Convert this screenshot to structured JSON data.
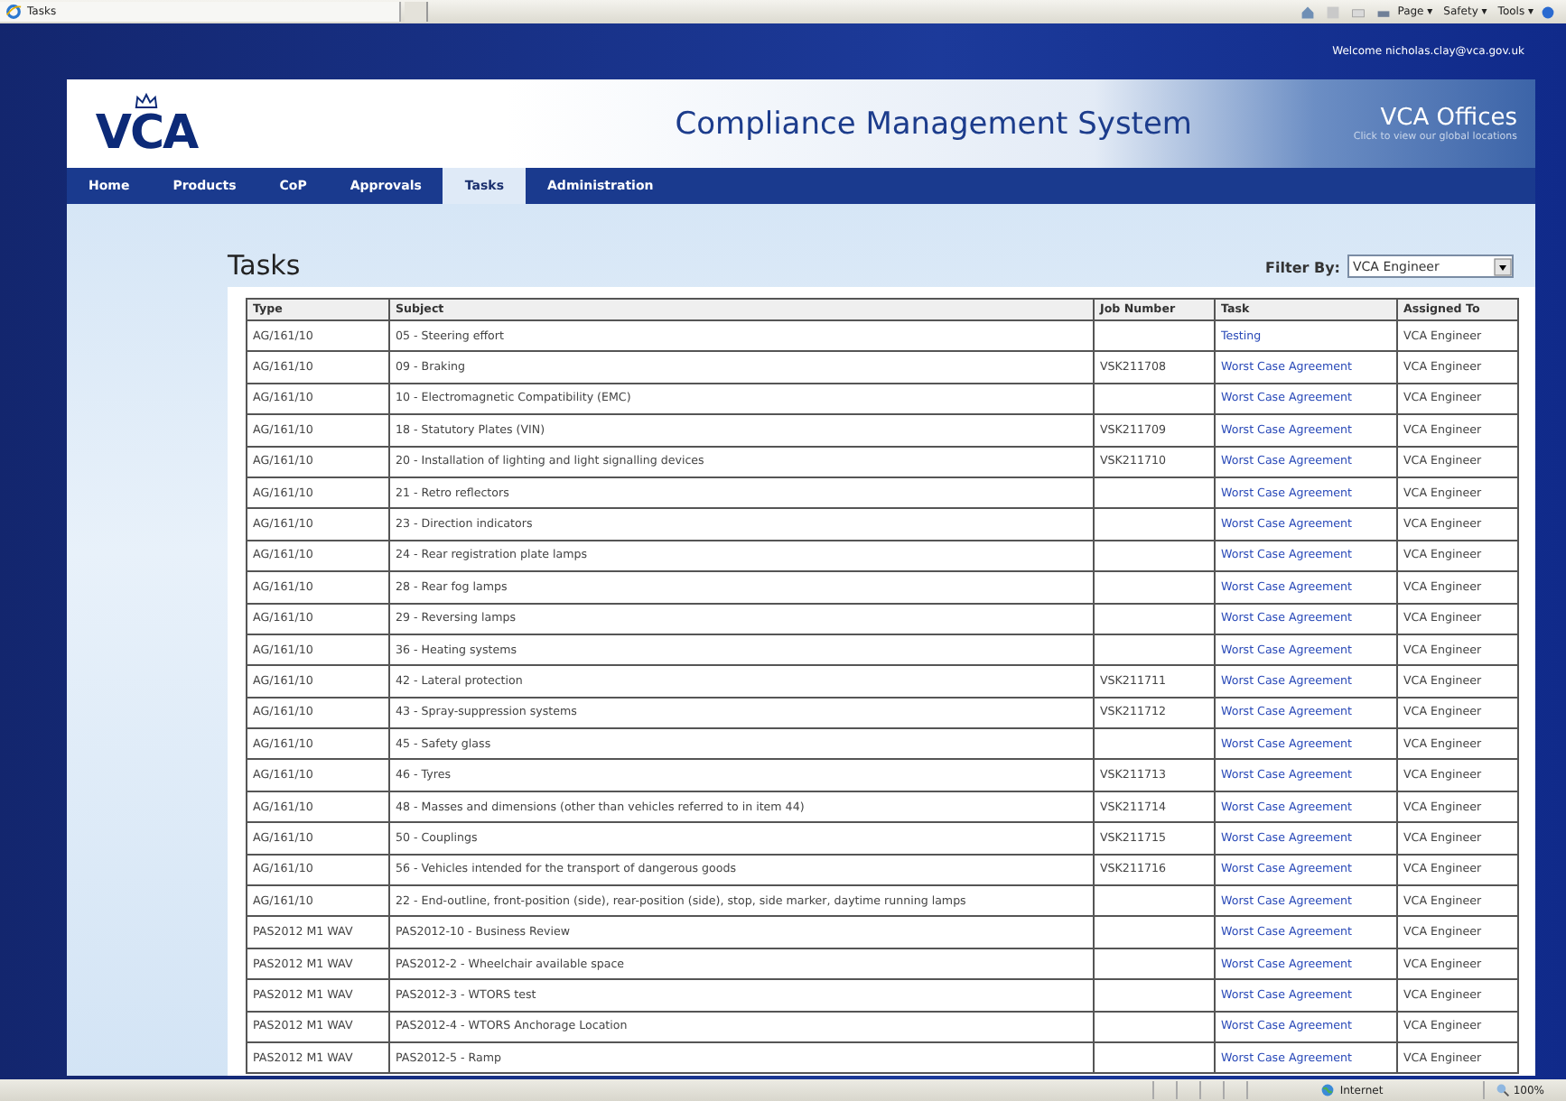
{
  "browser": {
    "tab_title": "Tasks",
    "commands": [
      "Page ▾",
      "Safety ▾",
      "Tools ▾"
    ],
    "status_zone": "Internet",
    "zoom": "100%"
  },
  "header": {
    "welcome": "Welcome nicholas.clay@vca.gov.uk",
    "logo_text": "VCA",
    "title": "Compliance Management System",
    "offices_title": "VCA Offices",
    "offices_subtitle": "Click to view our global locations"
  },
  "nav": [
    {
      "label": "Home",
      "selected": false
    },
    {
      "label": "Products",
      "selected": false
    },
    {
      "label": "CoP",
      "selected": false
    },
    {
      "label": "Approvals",
      "selected": false
    },
    {
      "label": "Tasks",
      "selected": true
    },
    {
      "label": "Administration",
      "selected": false
    }
  ],
  "page": {
    "heading": "Tasks",
    "filter_label": "Filter By:",
    "filter_value": "VCA Engineer"
  },
  "table": {
    "columns": [
      "Type",
      "Subject",
      "Job Number",
      "Task",
      "Assigned To"
    ],
    "rows": [
      {
        "type": "AG/161/10",
        "subject": "05 - Steering effort",
        "job": "",
        "task": "Testing",
        "assigned": "VCA Engineer"
      },
      {
        "type": "AG/161/10",
        "subject": "09 - Braking",
        "job": "VSK211708",
        "task": "Worst Case Agreement",
        "assigned": "VCA Engineer"
      },
      {
        "type": "AG/161/10",
        "subject": "10 - Electromagnetic Compatibility (EMC)",
        "job": "",
        "task": "Worst Case Agreement",
        "assigned": "VCA Engineer"
      },
      {
        "type": "AG/161/10",
        "subject": "18 - Statutory Plates (VIN)",
        "job": "VSK211709",
        "task": "Worst Case Agreement",
        "assigned": "VCA Engineer"
      },
      {
        "type": "AG/161/10",
        "subject": "20 - Installation of lighting and light signalling devices",
        "job": "VSK211710",
        "task": "Worst Case Agreement",
        "assigned": "VCA Engineer"
      },
      {
        "type": "AG/161/10",
        "subject": "21 - Retro reflectors",
        "job": "",
        "task": "Worst Case Agreement",
        "assigned": "VCA Engineer"
      },
      {
        "type": "AG/161/10",
        "subject": "23 - Direction indicators",
        "job": "",
        "task": "Worst Case Agreement",
        "assigned": "VCA Engineer"
      },
      {
        "type": "AG/161/10",
        "subject": "24 - Rear registration plate lamps",
        "job": "",
        "task": "Worst Case Agreement",
        "assigned": "VCA Engineer"
      },
      {
        "type": "AG/161/10",
        "subject": "28 - Rear fog lamps",
        "job": "",
        "task": "Worst Case Agreement",
        "assigned": "VCA Engineer"
      },
      {
        "type": "AG/161/10",
        "subject": "29 - Reversing lamps",
        "job": "",
        "task": "Worst Case Agreement",
        "assigned": "VCA Engineer"
      },
      {
        "type": "AG/161/10",
        "subject": "36 - Heating systems",
        "job": "",
        "task": "Worst Case Agreement",
        "assigned": "VCA Engineer"
      },
      {
        "type": "AG/161/10",
        "subject": "42 - Lateral protection",
        "job": "VSK211711",
        "task": "Worst Case Agreement",
        "assigned": "VCA Engineer"
      },
      {
        "type": "AG/161/10",
        "subject": "43 - Spray-suppression systems",
        "job": "VSK211712",
        "task": "Worst Case Agreement",
        "assigned": "VCA Engineer"
      },
      {
        "type": "AG/161/10",
        "subject": "45 - Safety glass",
        "job": "",
        "task": "Worst Case Agreement",
        "assigned": "VCA Engineer"
      },
      {
        "type": "AG/161/10",
        "subject": "46 - Tyres",
        "job": "VSK211713",
        "task": "Worst Case Agreement",
        "assigned": "VCA Engineer"
      },
      {
        "type": "AG/161/10",
        "subject": "48 - Masses and dimensions (other than vehicles referred to in item 44)",
        "job": "VSK211714",
        "task": "Worst Case Agreement",
        "assigned": "VCA Engineer"
      },
      {
        "type": "AG/161/10",
        "subject": "50 - Couplings",
        "job": "VSK211715",
        "task": "Worst Case Agreement",
        "assigned": "VCA Engineer"
      },
      {
        "type": "AG/161/10",
        "subject": "56 - Vehicles intended for the transport of dangerous goods",
        "job": "VSK211716",
        "task": "Worst Case Agreement",
        "assigned": "VCA Engineer"
      },
      {
        "type": "AG/161/10",
        "subject": "22 - End-outline, front-position (side), rear-position (side), stop, side marker, daytime running lamps",
        "job": "",
        "task": "Worst Case Agreement",
        "assigned": "VCA Engineer"
      },
      {
        "type": "PAS2012 M1 WAV",
        "subject": "PAS2012-10 - Business Review",
        "job": "",
        "task": "Worst Case Agreement",
        "assigned": "VCA Engineer"
      },
      {
        "type": "PAS2012 M1 WAV",
        "subject": "PAS2012-2 - Wheelchair available space",
        "job": "",
        "task": "Worst Case Agreement",
        "assigned": "VCA Engineer"
      },
      {
        "type": "PAS2012 M1 WAV",
        "subject": "PAS2012-3 - WTORS test",
        "job": "",
        "task": "Worst Case Agreement",
        "assigned": "VCA Engineer"
      },
      {
        "type": "PAS2012 M1 WAV",
        "subject": "PAS2012-4 - WTORS Anchorage Location",
        "job": "",
        "task": "Worst Case Agreement",
        "assigned": "VCA Engineer"
      },
      {
        "type": "PAS2012 M1 WAV",
        "subject": "PAS2012-5 - Ramp",
        "job": "",
        "task": "Worst Case Agreement",
        "assigned": "VCA Engineer"
      }
    ]
  }
}
